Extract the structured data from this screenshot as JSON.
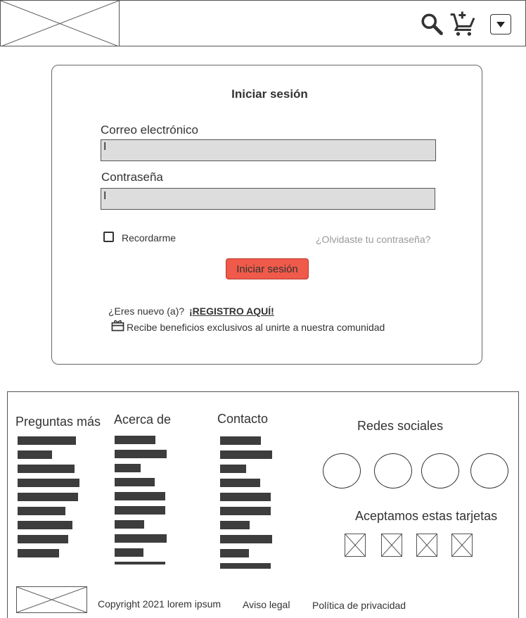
{
  "header": {
    "logo_icon": "image-placeholder",
    "search_icon": "search-icon",
    "cart_icon": "add-to-cart-icon",
    "menu_icon": "caret-down-icon"
  },
  "login": {
    "title": "Iniciar sesión",
    "email_label": "Correo electrónico",
    "email_value": "",
    "password_label": "Contraseña",
    "password_value": "",
    "cursor_mark": "I",
    "remember_label": "Recordarme",
    "remember_checked": false,
    "forgot_link": "¿Olvidaste tu contraseña?",
    "submit_label": "Iniciar sesión",
    "new_user_text": "¿Eres nuevo (a)?",
    "register_link": "¡REGISTRO AQUÍ!",
    "benefits_text": "Recibe beneficios exclusivos al unirte a nuestra comunidad",
    "benefits_icon": "gift-icon"
  },
  "footer": {
    "faq_heading": "Preguntas más",
    "about_heading": "Acerca de",
    "contact_heading": "Contacto",
    "social_heading": "Redes sociales",
    "cards_heading": "Aceptamos estas tarjetas",
    "copyright": "Copyright 2021 lorem ipsum",
    "legal_link": "Aviso legal",
    "privacy_link": "Política de privacidad"
  },
  "colors": {
    "accent_button": "#f05a4a",
    "input_bg": "#dddddd",
    "link_bar": "#3d3d3d",
    "muted_link": "#999999"
  }
}
